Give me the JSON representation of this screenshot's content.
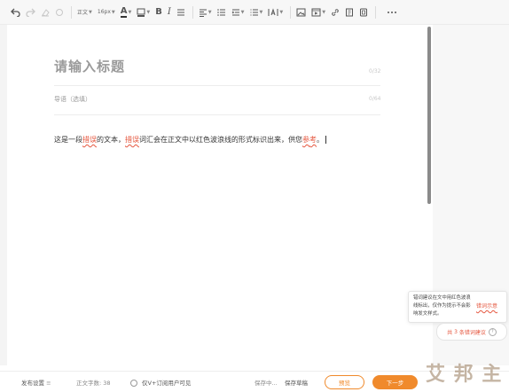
{
  "toolbar": {
    "font_family": "正文",
    "font_size": "16px",
    "font_color_label": "A",
    "bold_label": "B",
    "italic_label": "I"
  },
  "editor": {
    "title_placeholder": "请输入标题",
    "title_count": "0/32",
    "summary_placeholder": "导语（选填）",
    "summary_count": "0/64",
    "body": {
      "t1": "这是一段",
      "e1": "措误",
      "t2": "的文本，",
      "e2": "措误",
      "t3": "词汇会在正文中以红色波浪线的形式标识出来，供您",
      "e3": "参",
      "t4": "考",
      "t5": "。"
    }
  },
  "tooltip": {
    "text": "错词建议在文中用红色波浪线标出，仅作为提示不会影响发文样式。",
    "demo": "错词示意"
  },
  "suggestion": {
    "prefix": "共",
    "count": "3",
    "suffix": "条错词建议",
    "help": "?"
  },
  "footer": {
    "publish_settings": "发布设置",
    "publish_settings_icon": "≡",
    "word_count_label": "正文字数:",
    "word_count": "38",
    "visibility": "仅V+订阅用户可见",
    "save_status": "保存中...",
    "save_draft": "保存草稿",
    "preview": "预览",
    "next": "下一步"
  },
  "watermark": "艾 邦 主",
  "colors": {
    "accent": "#f08a2c",
    "error": "#e5573f"
  },
  "icons": [
    "undo-icon",
    "redo-icon",
    "clear-format-icon",
    "format-painter-icon",
    "font-color-icon",
    "highlight-icon",
    "bold-icon",
    "italic-icon",
    "strikethrough-icon",
    "align-icon",
    "ordered-list-icon",
    "indent-icon",
    "bullet-list-icon",
    "letter-spacing-icon",
    "image-icon",
    "video-icon",
    "link-icon",
    "audio-icon",
    "template-icon",
    "more-icon"
  ]
}
